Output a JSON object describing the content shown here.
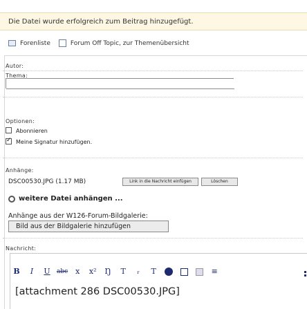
{
  "notice": "Die Datei wurde erfolgreich zum Beitrag hinzugefügt.",
  "nav": {
    "forum_list": "Forenliste",
    "forum_topic": "Forum Off Topic, zur Themenübersicht",
    "forum_list_icon": "folder-icon",
    "forum_topic_icon": "forum-icon"
  },
  "form": {
    "author_label": "Autor:",
    "subject_label": "Thema:",
    "subject_value": "",
    "options_label": "Optionen:",
    "options": [
      {
        "label": "Abonnieren",
        "checked": false
      },
      {
        "label": "Meine Signatur hinzufügen.",
        "checked": true
      }
    ],
    "attachments_label": "Anhänge:",
    "attachment": {
      "name": "DSC00530.JPG (1.17 MB)",
      "insert_link": "Link in die Nachricht einfügen",
      "delete": "Löschen"
    },
    "more_files": "weitere Datei anhängen ...",
    "gallery_text": "Anhänge aus der W126-Forum-Bildgalerie:",
    "gallery_button": "Bild aus der Bildgalerie hinzufügen",
    "message_label": "Nachricht:",
    "toolbar": [
      "B",
      "I",
      "U",
      "abc",
      "x",
      "x²",
      "Ŋ",
      "T",
      "ᵣ",
      "T"
    ],
    "message_text": "[attachment 286 DSC00530.JPG]"
  },
  "colors": {
    "notice_bg": "#fdf7e3",
    "toolbar_icon": "#1e2a70"
  }
}
